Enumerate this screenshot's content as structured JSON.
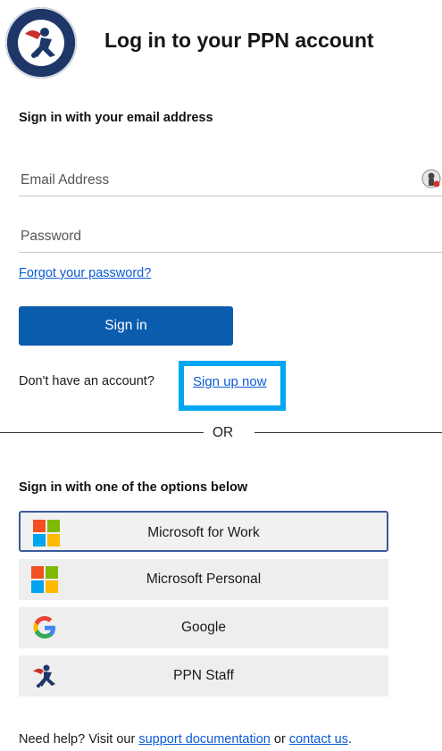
{
  "header": {
    "title": "Log in to your PPN account",
    "logo_text": "PEDIATRIC PANDEMIC NETWORK"
  },
  "email_section": {
    "heading": "Sign in with your email address",
    "email_placeholder": "Email Address",
    "password_placeholder": "Password",
    "forgot_label": "Forgot your password?",
    "signin_label": "Sign in",
    "no_account_text": "Don't have an account?",
    "signup_label": "Sign up now"
  },
  "divider": {
    "label": "OR"
  },
  "providers_section": {
    "heading": "Sign in with one of the options below",
    "providers": [
      {
        "label": "Microsoft for Work",
        "icon": "microsoft-icon"
      },
      {
        "label": "Microsoft Personal",
        "icon": "microsoft-icon"
      },
      {
        "label": "Google",
        "icon": "google-icon"
      },
      {
        "label": "PPN Staff",
        "icon": "ppn-staff-icon"
      }
    ]
  },
  "footer": {
    "prefix": "Need help? Visit our",
    "support_link": "support documentation",
    "middle": "or",
    "contact_link": "contact us",
    "suffix": "."
  },
  "colors": {
    "primary_button": "#0a5cad",
    "link": "#0b5ad6",
    "highlight": "#00a6f0",
    "provider_bg": "#eeeeee"
  }
}
